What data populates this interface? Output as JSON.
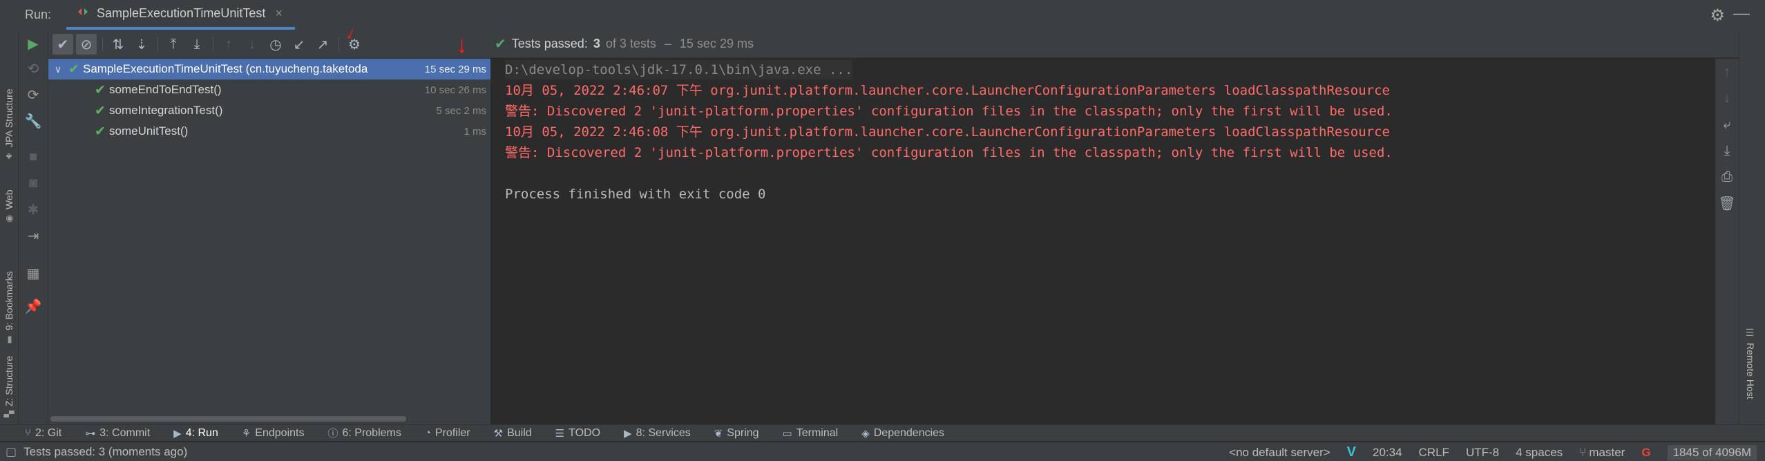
{
  "run_header": {
    "label": "Run:",
    "tab_title": "SampleExecutionTimeUnitTest",
    "tab_close": "×"
  },
  "left_stripe": {
    "items": [
      {
        "label": "JPA Structure",
        "icon": "jpa-icon"
      },
      {
        "label": "Web",
        "icon": "globe-icon"
      },
      {
        "label": "9: Bookmarks",
        "icon": "bookmark-icon"
      },
      {
        "label": "Z: Structure",
        "icon": "structure-icon"
      }
    ]
  },
  "status_banner": {
    "passed_label": "Tests passed:",
    "passed_count": "3",
    "of_total": "of 3 tests",
    "separator": "–",
    "duration": "15 sec 29 ms"
  },
  "tree": {
    "root": {
      "name": "SampleExecutionTimeUnitTest (cn.tuyucheng.taketoda",
      "duration": "15 sec 29 ms"
    },
    "tests": [
      {
        "name": "someEndToEndTest()",
        "duration": "10 sec 26 ms"
      },
      {
        "name": "someIntegrationTest()",
        "duration": "5 sec 2 ms"
      },
      {
        "name": "someUnitTest()",
        "duration": "1 ms"
      }
    ]
  },
  "console": {
    "lines": [
      {
        "kind": "cmd",
        "text": "D:\\develop-tools\\jdk-17.0.1\\bin\\java.exe ..."
      },
      {
        "kind": "warn",
        "text": "10月 05, 2022 2:46:07 下午 org.junit.platform.launcher.core.LauncherConfigurationParameters loadClasspathResource"
      },
      {
        "kind": "warn",
        "text": "警告: Discovered 2 'junit-platform.properties' configuration files in the classpath; only the first will be used."
      },
      {
        "kind": "warn",
        "text": "10月 05, 2022 2:46:08 下午 org.junit.platform.launcher.core.LauncherConfigurationParameters loadClasspathResource"
      },
      {
        "kind": "warn",
        "text": "警告: Discovered 2 'junit-platform.properties' configuration files in the classpath; only the first will be used."
      },
      {
        "kind": "blank",
        "text": ""
      },
      {
        "kind": "normal",
        "text": "Process finished with exit code 0"
      }
    ]
  },
  "right_stripe": {
    "remote_host": "Remote Host"
  },
  "tool_tabs": [
    {
      "label": "2: Git",
      "icon": "git-icon"
    },
    {
      "label": "3: Commit",
      "icon": "commit-icon"
    },
    {
      "label": "4: Run",
      "icon": "run-icon",
      "active": true
    },
    {
      "label": "Endpoints",
      "icon": "endpoints-icon"
    },
    {
      "label": "6: Problems",
      "icon": "problems-icon"
    },
    {
      "label": "Profiler",
      "icon": "profiler-icon"
    },
    {
      "label": "Build",
      "icon": "build-icon"
    },
    {
      "label": "TODO",
      "icon": "todo-icon"
    },
    {
      "label": "8: Services",
      "icon": "services-icon"
    },
    {
      "label": "Spring",
      "icon": "spring-icon"
    },
    {
      "label": "Terminal",
      "icon": "terminal-icon"
    },
    {
      "label": "Dependencies",
      "icon": "dependencies-icon"
    }
  ],
  "status_bar": {
    "message": "Tests passed: 3 (moments ago)",
    "server": "<no default server>",
    "position": "20:34",
    "line_separator": "CRLF",
    "encoding": "UTF-8",
    "indent": "4 spaces",
    "branch": "master",
    "memory": "1845 of 4096M"
  },
  "colors": {
    "accent": "#4b6eaf",
    "tab_underline": "#4a88c7",
    "pass_green": "#5eb55f",
    "warn_red": "#ff6b68",
    "annotation_red": "#ff1a1a"
  }
}
